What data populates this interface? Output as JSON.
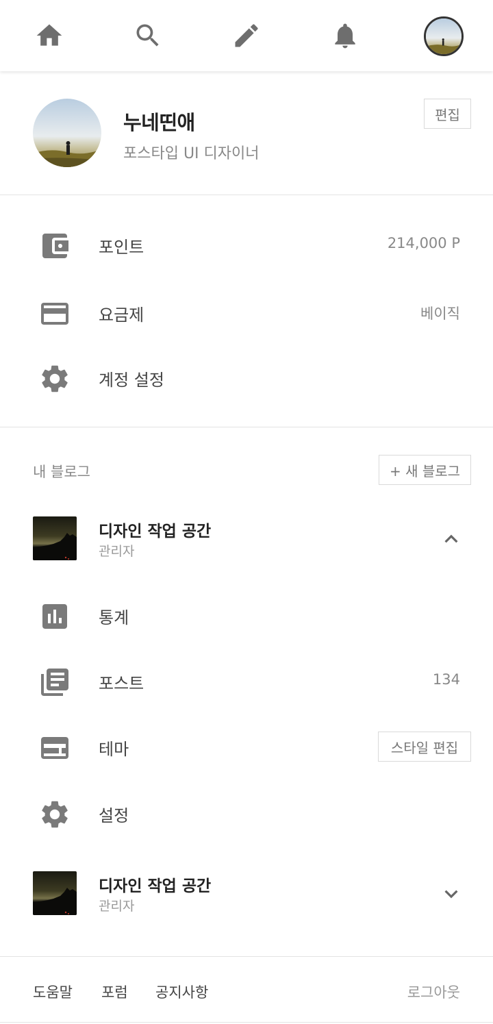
{
  "nav": {
    "icons": [
      "home-icon",
      "search-icon",
      "pencil-icon",
      "bell-icon",
      "profile-avatar"
    ]
  },
  "profile": {
    "name": "누네띤애",
    "role": "포스타입 UI 디자이너",
    "edit_label": "편집"
  },
  "menu": {
    "items": [
      {
        "icon": "wallet-icon",
        "label": "포인트",
        "value": "214,000 P"
      },
      {
        "icon": "credit-card-icon",
        "label": "요금제",
        "value": "베이직"
      },
      {
        "icon": "gear-icon",
        "label": "계정 설정",
        "value": ""
      }
    ]
  },
  "blogs": {
    "title": "내 블로그",
    "new_blog_label": "+ 새 블로그",
    "items": [
      {
        "name": "디자인 작업 공간",
        "role": "관리자",
        "expanded": true,
        "submenu": [
          {
            "icon": "bar-chart-icon",
            "label": "통계",
            "value": ""
          },
          {
            "icon": "posts-icon",
            "label": "포스트",
            "value": "134"
          },
          {
            "icon": "theme-icon",
            "label": "테마",
            "button": "스타일 편집"
          },
          {
            "icon": "gear-icon",
            "label": "설정",
            "value": ""
          }
        ]
      },
      {
        "name": "디자인 작업 공간",
        "role": "관리자",
        "expanded": false
      }
    ]
  },
  "footer": {
    "links": [
      "도움말",
      "포럼",
      "공지사항"
    ],
    "logout": "로그아웃"
  },
  "colors": {
    "icon": "#7a7a7a",
    "text": "#444444",
    "muted": "#888888",
    "divider": "#e3e3e3"
  }
}
